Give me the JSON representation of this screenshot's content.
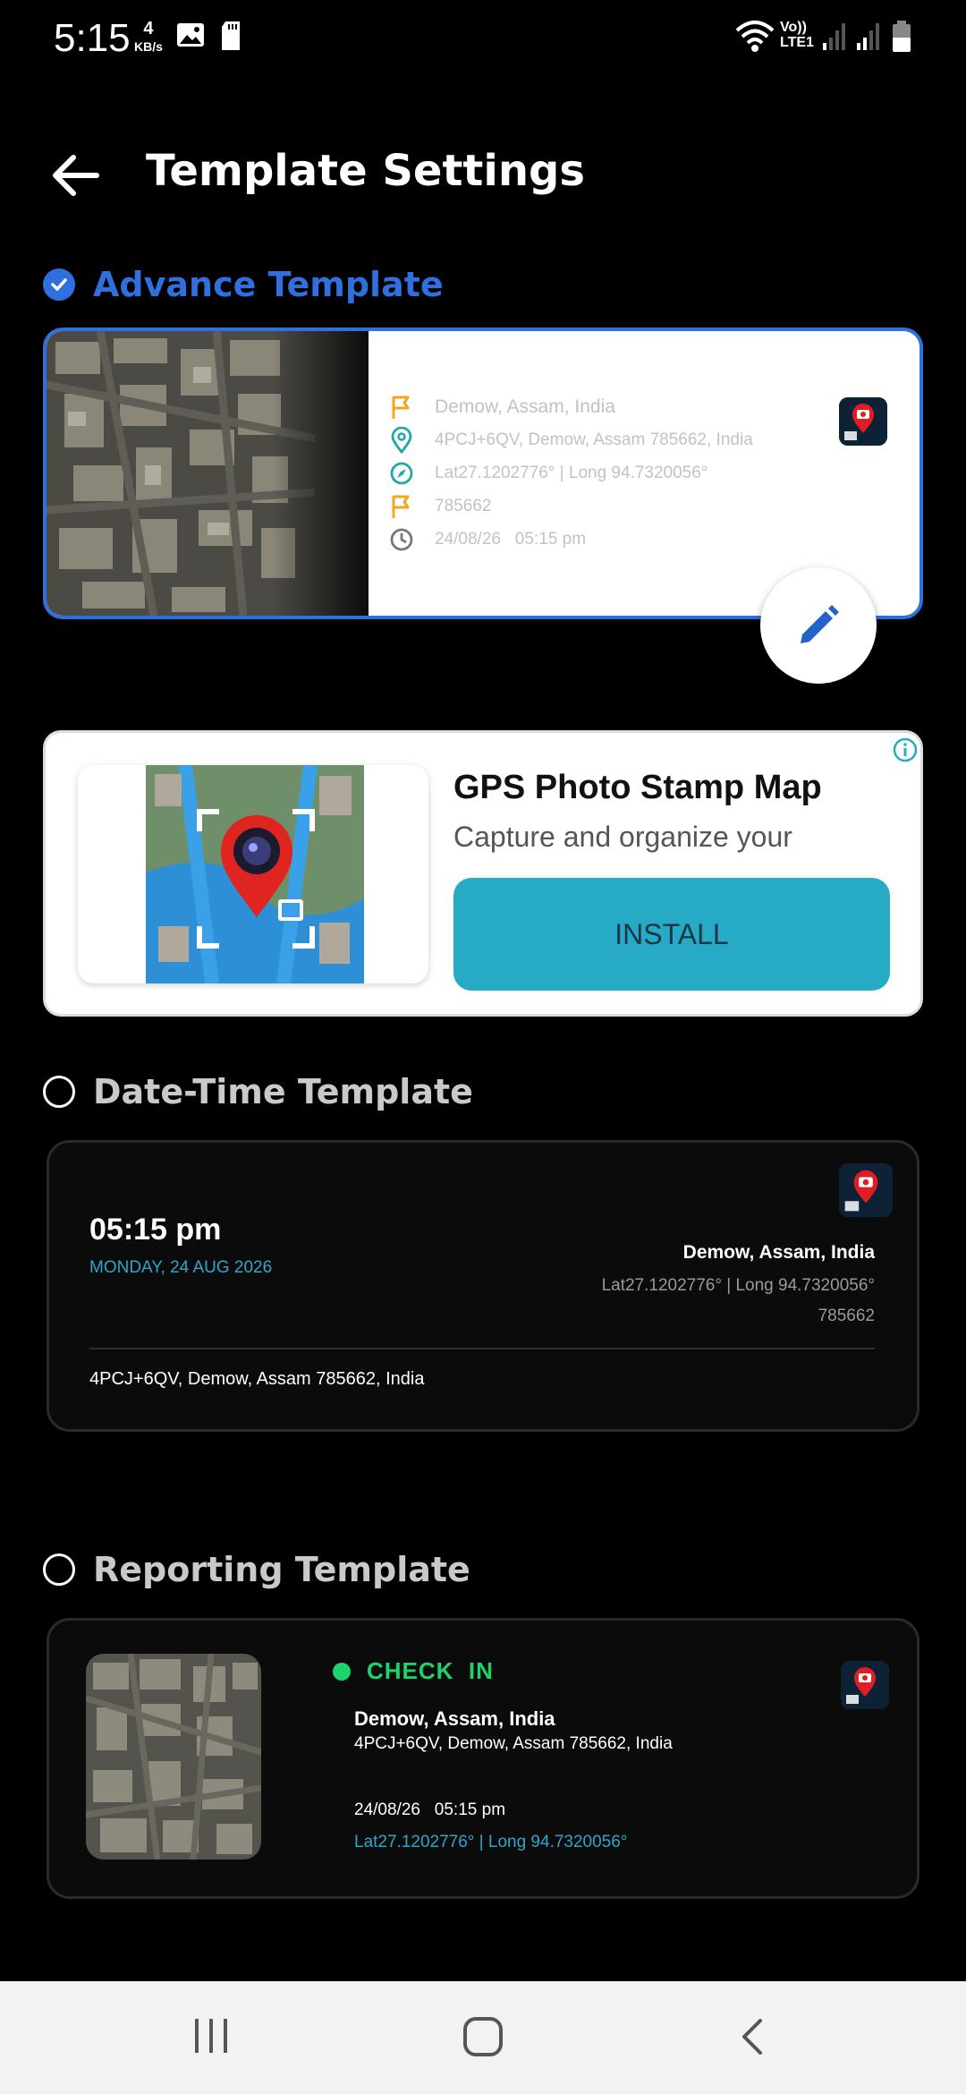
{
  "status_bar": {
    "time": "5:15",
    "speed_value": "4",
    "speed_unit": "KB/s",
    "network_label_top": "Vo))",
    "network_label_bottom": "LTE1"
  },
  "header": {
    "title": "Template Settings"
  },
  "advance_template": {
    "label": "Advance Template",
    "selected": true,
    "location": "Demow, Assam, India",
    "address": "4PCJ+6QV, Demow, Assam 785662, India",
    "coords": "Lat27.1202776° | Long 94.7320056°",
    "pincode": "785662",
    "datetime": "24/08/26   05:15 pm"
  },
  "ad": {
    "title": "GPS Photo Stamp Map",
    "subtitle": "Capture and organize your",
    "cta": "INSTALL"
  },
  "datetime_template": {
    "label": "Date-Time Template",
    "selected": false,
    "time": "05:15 pm",
    "date": "MONDAY, 24 AUG 2026",
    "location": "Demow, Assam, India",
    "coords": "Lat27.1202776° | Long 94.7320056°",
    "pincode": "785662",
    "address": "4PCJ+6QV, Demow, Assam 785662, India"
  },
  "reporting_template": {
    "label": "Reporting Template",
    "selected": false,
    "status": "CHECK  IN",
    "location": "Demow, Assam, India",
    "address": "4PCJ+6QV, Demow, Assam 785662, India",
    "datetime": "24/08/26   05:15 pm",
    "coords": "Lat27.1202776° | Long 94.7320056°"
  },
  "colors": {
    "accent": "#2f6fde",
    "check_in": "#1dd36b",
    "teal": "#2fa6c9",
    "install": "#27aac6"
  }
}
